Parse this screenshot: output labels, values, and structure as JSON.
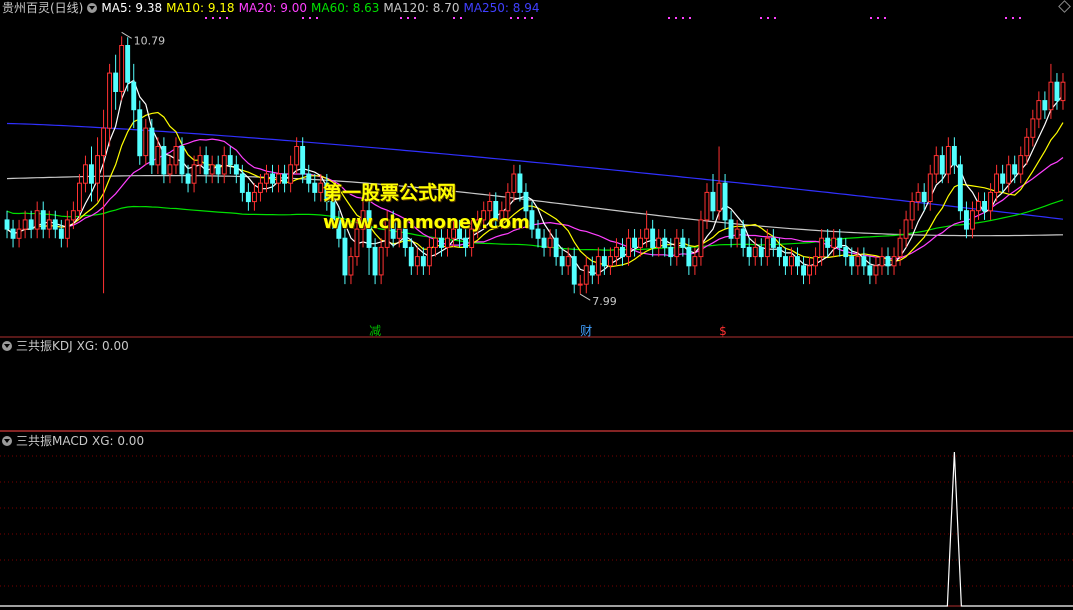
{
  "main_panel": {
    "title": "贵州百灵(日线)",
    "ma_labels": [
      {
        "text": "MA5: 9.38",
        "color": "#ffffff"
      },
      {
        "text": "MA10: 9.18",
        "color": "#ffff00"
      },
      {
        "text": "MA20: 9.00",
        "color": "#ff40ff"
      },
      {
        "text": "MA60: 8.63",
        "color": "#00e000"
      },
      {
        "text": "MA120: 8.70",
        "color": "#c8c8c8"
      },
      {
        "text": "MA250: 8.94",
        "color": "#4040ff"
      }
    ],
    "high_label": "10.79",
    "low_label": "7.99",
    "events": [
      {
        "text": "减",
        "color": "#00c000",
        "index": 61
      },
      {
        "text": "财",
        "color": "#40a0ff",
        "index": 96
      },
      {
        "text": "$",
        "color": "#ff3030",
        "index": 119
      }
    ]
  },
  "kdj_panel": {
    "title": "三共振KDJ",
    "xg_label": "XG: 0.00"
  },
  "macd_panel": {
    "title": "三共振MACD",
    "xg_label": "XG: 0.00"
  },
  "watermark": {
    "line1": "第一股票公式网",
    "line2": "www.chnmoney.com"
  },
  "colors": {
    "up": "#ff3232",
    "down": "#54ffff",
    "ma5": "#ffffff",
    "ma10": "#ffff00",
    "ma20": "#ff40ff",
    "ma60": "#00e000",
    "ma120": "#c8c8c8",
    "ma250": "#3030ff",
    "divider": "#b03030",
    "grid": "#7a0000",
    "signal": "#ffffff"
  },
  "chart_data": {
    "type": "candlestick",
    "price_range": [
      7.6,
      11.0
    ],
    "candles": [
      [
        8.8,
        8.7,
        8.9,
        8.6
      ],
      [
        8.7,
        8.6,
        8.8,
        8.5
      ],
      [
        8.6,
        8.7,
        8.8,
        8.5
      ],
      [
        8.7,
        8.8,
        8.9,
        8.6
      ],
      [
        8.8,
        8.7,
        8.9,
        8.6
      ],
      [
        8.7,
        8.9,
        9.0,
        8.6
      ],
      [
        8.9,
        8.7,
        9.0,
        8.6
      ],
      [
        8.7,
        8.8,
        8.9,
        8.6
      ],
      [
        8.8,
        8.7,
        8.9,
        8.6
      ],
      [
        8.7,
        8.6,
        8.8,
        8.5
      ],
      [
        8.6,
        8.8,
        8.9,
        8.5
      ],
      [
        8.8,
        8.9,
        9.0,
        8.7
      ],
      [
        8.9,
        9.2,
        9.3,
        8.8
      ],
      [
        9.2,
        9.4,
        9.5,
        9.1
      ],
      [
        9.4,
        9.2,
        9.6,
        9.0
      ],
      [
        9.2,
        9.5,
        9.7,
        9.0
      ],
      [
        9.5,
        9.8,
        10.0,
        8.0
      ],
      [
        9.8,
        10.4,
        10.5,
        9.6
      ],
      [
        10.4,
        10.2,
        10.6,
        10.0
      ],
      [
        10.2,
        10.7,
        10.8,
        10.1
      ],
      [
        10.7,
        10.3,
        10.79,
        10.2
      ],
      [
        10.3,
        10.0,
        10.5,
        9.8
      ],
      [
        10.0,
        9.5,
        10.1,
        9.4
      ],
      [
        9.5,
        9.8,
        9.9,
        9.4
      ],
      [
        9.8,
        9.4,
        9.9,
        9.3
      ],
      [
        9.4,
        9.6,
        9.7,
        9.3
      ],
      [
        9.6,
        9.3,
        9.7,
        9.2
      ],
      [
        9.3,
        9.4,
        9.5,
        9.2
      ],
      [
        9.4,
        9.6,
        9.7,
        9.3
      ],
      [
        9.6,
        9.3,
        9.7,
        9.2
      ],
      [
        9.3,
        9.2,
        9.4,
        9.1
      ],
      [
        9.2,
        9.4,
        9.5,
        9.1
      ],
      [
        9.4,
        9.5,
        9.6,
        9.3
      ],
      [
        9.5,
        9.3,
        9.6,
        9.2
      ],
      [
        9.3,
        9.4,
        9.5,
        9.2
      ],
      [
        9.4,
        9.3,
        9.5,
        9.2
      ],
      [
        9.3,
        9.5,
        9.6,
        9.2
      ],
      [
        9.5,
        9.4,
        9.6,
        9.3
      ],
      [
        9.4,
        9.3,
        9.5,
        9.2
      ],
      [
        9.3,
        9.1,
        9.4,
        9.0
      ],
      [
        9.1,
        9.0,
        9.2,
        8.9
      ],
      [
        9.0,
        9.1,
        9.2,
        8.9
      ],
      [
        9.1,
        9.2,
        9.3,
        9.0
      ],
      [
        9.2,
        9.3,
        9.4,
        9.1
      ],
      [
        9.3,
        9.2,
        9.4,
        9.1
      ],
      [
        9.2,
        9.3,
        9.4,
        9.1
      ],
      [
        9.3,
        9.2,
        9.4,
        9.1
      ],
      [
        9.2,
        9.4,
        9.5,
        9.1
      ],
      [
        9.4,
        9.6,
        9.7,
        9.3
      ],
      [
        9.6,
        9.3,
        9.7,
        9.2
      ],
      [
        9.3,
        9.2,
        9.4,
        9.1
      ],
      [
        9.2,
        9.1,
        9.3,
        9.0
      ],
      [
        9.1,
        9.2,
        9.3,
        9.0
      ],
      [
        9.2,
        9.0,
        9.3,
        8.9
      ],
      [
        9.0,
        8.8,
        9.1,
        8.7
      ],
      [
        8.8,
        8.6,
        8.9,
        8.5
      ],
      [
        8.6,
        8.2,
        8.7,
        8.1
      ],
      [
        8.2,
        8.4,
        8.5,
        8.1
      ],
      [
        8.4,
        8.7,
        8.8,
        8.3
      ],
      [
        8.7,
        8.9,
        9.0,
        8.5
      ],
      [
        8.9,
        8.5,
        9.0,
        8.2
      ],
      [
        8.5,
        8.2,
        8.6,
        8.1
      ],
      [
        8.2,
        8.5,
        8.6,
        8.1
      ],
      [
        8.5,
        8.8,
        8.9,
        8.4
      ],
      [
        8.8,
        8.6,
        8.9,
        8.5
      ],
      [
        8.6,
        8.7,
        8.8,
        8.5
      ],
      [
        8.7,
        8.5,
        8.8,
        8.4
      ],
      [
        8.5,
        8.3,
        8.6,
        8.2
      ],
      [
        8.3,
        8.4,
        8.5,
        8.2
      ],
      [
        8.4,
        8.3,
        8.5,
        8.2
      ],
      [
        8.3,
        8.5,
        8.6,
        8.2
      ],
      [
        8.5,
        8.6,
        8.7,
        8.4
      ],
      [
        8.6,
        8.5,
        8.7,
        8.4
      ],
      [
        8.5,
        8.6,
        8.7,
        8.4
      ],
      [
        8.6,
        8.7,
        8.8,
        8.5
      ],
      [
        8.7,
        8.6,
        8.8,
        8.5
      ],
      [
        8.6,
        8.5,
        8.7,
        8.4
      ],
      [
        8.5,
        8.7,
        8.8,
        8.4
      ],
      [
        8.7,
        8.8,
        8.9,
        8.6
      ],
      [
        8.8,
        8.9,
        9.0,
        8.7
      ],
      [
        8.9,
        9.0,
        9.1,
        8.8
      ],
      [
        9.0,
        8.8,
        9.1,
        8.7
      ],
      [
        8.8,
        8.9,
        9.0,
        8.7
      ],
      [
        8.9,
        9.1,
        9.2,
        8.8
      ],
      [
        9.1,
        9.3,
        9.4,
        9.0
      ],
      [
        9.3,
        9.1,
        9.4,
        9.0
      ],
      [
        9.1,
        8.9,
        9.2,
        8.8
      ],
      [
        8.9,
        8.7,
        9.0,
        8.6
      ],
      [
        8.7,
        8.6,
        8.8,
        8.5
      ],
      [
        8.6,
        8.5,
        8.7,
        8.4
      ],
      [
        8.5,
        8.6,
        8.7,
        8.4
      ],
      [
        8.6,
        8.4,
        8.7,
        8.3
      ],
      [
        8.4,
        8.3,
        8.5,
        8.2
      ],
      [
        8.3,
        8.4,
        8.5,
        8.2
      ],
      [
        8.4,
        8.1,
        8.5,
        8.0
      ],
      [
        8.1,
        8.1,
        8.2,
        7.99
      ],
      [
        8.1,
        8.3,
        8.4,
        8.0
      ],
      [
        8.3,
        8.2,
        8.4,
        8.1
      ],
      [
        8.2,
        8.4,
        8.5,
        8.1
      ],
      [
        8.4,
        8.3,
        8.5,
        8.2
      ],
      [
        8.3,
        8.4,
        8.5,
        8.2
      ],
      [
        8.4,
        8.5,
        8.6,
        8.3
      ],
      [
        8.5,
        8.4,
        8.6,
        8.3
      ],
      [
        8.4,
        8.6,
        8.7,
        8.3
      ],
      [
        8.6,
        8.5,
        8.7,
        8.4
      ],
      [
        8.5,
        8.6,
        8.7,
        8.4
      ],
      [
        8.6,
        8.7,
        8.9,
        8.5
      ],
      [
        8.7,
        8.5,
        8.8,
        8.4
      ],
      [
        8.5,
        8.6,
        8.7,
        8.4
      ],
      [
        8.6,
        8.5,
        8.7,
        8.4
      ],
      [
        8.5,
        8.4,
        8.6,
        8.3
      ],
      [
        8.4,
        8.6,
        8.7,
        8.3
      ],
      [
        8.6,
        8.5,
        8.7,
        8.4
      ],
      [
        8.5,
        8.3,
        8.6,
        8.2
      ],
      [
        8.3,
        8.4,
        8.5,
        8.2
      ],
      [
        8.4,
        8.8,
        8.9,
        8.3
      ],
      [
        8.8,
        9.1,
        9.2,
        8.7
      ],
      [
        9.1,
        8.9,
        9.3,
        8.8
      ],
      [
        8.9,
        9.2,
        9.6,
        8.8
      ],
      [
        9.2,
        8.8,
        9.3,
        8.7
      ],
      [
        8.8,
        8.6,
        8.9,
        8.5
      ],
      [
        8.6,
        8.7,
        8.8,
        8.5
      ],
      [
        8.7,
        8.5,
        8.8,
        8.4
      ],
      [
        8.5,
        8.4,
        8.6,
        8.3
      ],
      [
        8.4,
        8.5,
        8.6,
        8.3
      ],
      [
        8.5,
        8.4,
        8.6,
        8.3
      ],
      [
        8.4,
        8.6,
        8.7,
        8.3
      ],
      [
        8.6,
        8.5,
        8.7,
        8.4
      ],
      [
        8.5,
        8.4,
        8.6,
        8.3
      ],
      [
        8.4,
        8.3,
        8.5,
        8.2
      ],
      [
        8.3,
        8.4,
        8.5,
        8.2
      ],
      [
        8.4,
        8.3,
        8.5,
        8.2
      ],
      [
        8.3,
        8.2,
        8.4,
        8.1
      ],
      [
        8.2,
        8.3,
        8.4,
        8.1
      ],
      [
        8.3,
        8.4,
        8.5,
        8.2
      ],
      [
        8.4,
        8.6,
        8.7,
        8.3
      ],
      [
        8.6,
        8.5,
        8.7,
        8.4
      ],
      [
        8.5,
        8.6,
        8.7,
        8.4
      ],
      [
        8.6,
        8.5,
        8.7,
        8.4
      ],
      [
        8.5,
        8.4,
        8.6,
        8.3
      ],
      [
        8.4,
        8.3,
        8.5,
        8.2
      ],
      [
        8.3,
        8.4,
        8.5,
        8.2
      ],
      [
        8.4,
        8.3,
        8.5,
        8.2
      ],
      [
        8.3,
        8.2,
        8.4,
        8.1
      ],
      [
        8.2,
        8.3,
        8.4,
        8.1
      ],
      [
        8.3,
        8.4,
        8.5,
        8.2
      ],
      [
        8.4,
        8.3,
        8.5,
        8.2
      ],
      [
        8.3,
        8.4,
        8.5,
        8.2
      ],
      [
        8.4,
        8.6,
        8.7,
        8.3
      ],
      [
        8.6,
        8.8,
        8.9,
        8.5
      ],
      [
        8.8,
        9.0,
        9.1,
        8.7
      ],
      [
        9.0,
        9.1,
        9.2,
        8.9
      ],
      [
        9.1,
        9.0,
        9.2,
        8.9
      ],
      [
        9.0,
        9.3,
        9.4,
        8.9
      ],
      [
        9.3,
        9.5,
        9.6,
        9.2
      ],
      [
        9.5,
        9.3,
        9.6,
        9.2
      ],
      [
        9.3,
        9.6,
        9.7,
        9.2
      ],
      [
        9.6,
        9.4,
        9.7,
        9.3
      ],
      [
        9.4,
        8.9,
        9.5,
        8.8
      ],
      [
        8.9,
        8.7,
        9.0,
        8.6
      ],
      [
        8.7,
        8.9,
        9.0,
        8.6
      ],
      [
        8.9,
        9.0,
        9.1,
        8.8
      ],
      [
        9.0,
        8.9,
        9.1,
        8.8
      ],
      [
        8.9,
        9.1,
        9.2,
        8.8
      ],
      [
        9.1,
        9.3,
        9.4,
        9.0
      ],
      [
        9.3,
        9.2,
        9.4,
        9.1
      ],
      [
        9.2,
        9.4,
        9.5,
        9.1
      ],
      [
        9.4,
        9.3,
        9.5,
        9.2
      ],
      [
        9.3,
        9.5,
        9.6,
        9.2
      ],
      [
        9.5,
        9.7,
        9.8,
        9.4
      ],
      [
        9.7,
        9.9,
        10.0,
        9.6
      ],
      [
        9.9,
        10.1,
        10.2,
        9.8
      ],
      [
        10.1,
        10.0,
        10.2,
        9.9
      ],
      [
        10.0,
        10.3,
        10.5,
        9.9
      ],
      [
        10.3,
        10.1,
        10.4,
        10.0
      ],
      [
        10.1,
        10.3,
        10.4,
        10.0
      ]
    ]
  },
  "macd_signal": {
    "type": "line",
    "peak_index": 157,
    "peak_value": 1.0,
    "baseline_value": 0.0
  }
}
